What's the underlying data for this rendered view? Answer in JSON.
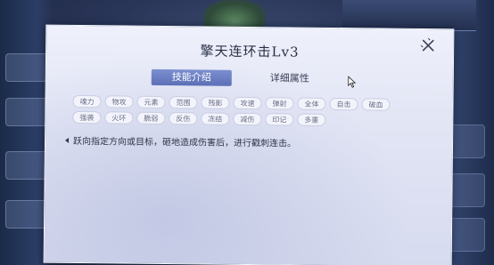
{
  "background": {
    "top_left_tab": "",
    "side_items": 4,
    "right_items": 3
  },
  "dialog": {
    "title": "擎天连环击Lv3",
    "close_icon": "close-icon",
    "tabs": [
      {
        "label": "技能介绍",
        "active": true
      },
      {
        "label": "详细属性",
        "active": false
      }
    ],
    "tag_rows": [
      [
        "魂力",
        "物攻",
        "元素",
        "范围",
        "残影",
        "攻速",
        "弹射",
        "全体",
        "自击",
        "破血"
      ],
      [
        "强袭",
        "火环",
        "脆弱",
        "反伤",
        "冻结",
        "减伤",
        "印记",
        "多重"
      ]
    ],
    "description": "跃向指定方向或目标，砸地造成伤害后，进行戳刺连击。"
  },
  "colors": {
    "tab_active": "#5b6fb6",
    "dialog_bg": "#e3e6f5",
    "scene_bg": "#2a3658"
  }
}
